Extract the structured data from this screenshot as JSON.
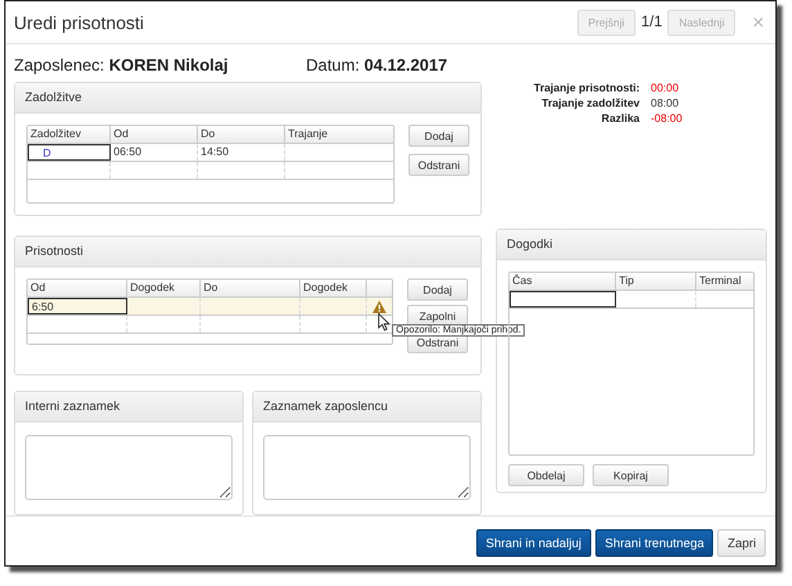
{
  "dialog": {
    "title": "Uredi prisotnosti",
    "prev_button": {
      "label": "Prejšnji",
      "disabled": true
    },
    "page_indicator": "1/1",
    "next_button": {
      "label": "Naslednji",
      "disabled": true
    },
    "close": "×"
  },
  "employee": {
    "label": "Zaposlenec:",
    "value": "KOREN Nikolaj"
  },
  "date": {
    "label": "Datum:",
    "value": "04.12.2017"
  },
  "assignments": {
    "title": "Zadolžitve",
    "columns": [
      "Zadolžitev",
      "Od",
      "Do",
      "Trajanje"
    ],
    "rows": [
      {
        "assignment": "D",
        "from": "06:50",
        "to": "14:50"
      }
    ],
    "buttons": [
      "Dodaj",
      "Odstrani"
    ]
  },
  "summary": [
    {
      "label": "Trajanje prisotnosti:",
      "value": "00:00",
      "alert": true
    },
    {
      "label": "Trajanje zadolžitev",
      "value": "08:00",
      "alert": false
    },
    {
      "label": "Razlika",
      "value": "-08:00",
      "alert": true
    }
  ],
  "attendance": {
    "title": "Prisotnosti",
    "columns": [
      "Od",
      "Dogodek",
      "Do",
      "Dogodek"
    ],
    "rows": [
      {
        "from": "6:50",
        "warning": true
      }
    ],
    "buttons": [
      "Dodaj",
      "Zapolni",
      "Odstrani"
    ],
    "tooltip": "Opozorilo: Manjkajoči prihod."
  },
  "events": {
    "title": "Dogodki",
    "columns": [
      "Čas",
      "Tip",
      "Terminal"
    ],
    "buttons": [
      "Obdelaj",
      "Kopiraj"
    ]
  },
  "notes": [
    {
      "title": "Interni zaznamek"
    },
    {
      "title": "Zaznamek zaposlencu"
    }
  ],
  "footer_buttons": [
    {
      "label": "Shrani in nadaljuj",
      "kind": "primary"
    },
    {
      "label": "Shrani trenutnega",
      "kind": "primary"
    },
    {
      "label": "Zapri",
      "kind": "default"
    }
  ]
}
